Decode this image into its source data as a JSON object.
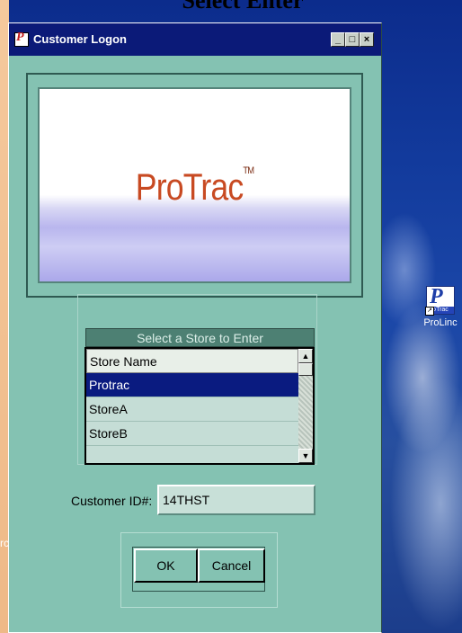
{
  "page_title": "Select Enter",
  "desktop": {
    "left_text": "rc",
    "icon": {
      "name": "protrac-icon",
      "glyph": "P",
      "sub": "oTrac",
      "shortcut_arrow": "↗",
      "label": "ProLinc"
    }
  },
  "window": {
    "title": "Customer Logon",
    "controls": {
      "minimize": "_",
      "maximize": "□",
      "close": "×"
    },
    "app_icon_glyph": "P",
    "logo": {
      "text": "ProTrac",
      "tm": "TM"
    },
    "store_list": {
      "header": "Select a Store to Enter",
      "rows": [
        {
          "label": "Store Name",
          "type": "header"
        },
        {
          "label": "Protrac",
          "type": "selected"
        },
        {
          "label": "StoreA",
          "type": "normal"
        },
        {
          "label": "StoreB",
          "type": "normal"
        }
      ],
      "scroll_up": "▲",
      "scroll_down": "▼"
    },
    "customer_id": {
      "label": "Customer ID#:",
      "value": "14THST"
    },
    "buttons": {
      "ok": "OK",
      "cancel": "Cancel"
    }
  },
  "colors": {
    "window_bg": "#84c2b2",
    "titlebar": "#0b1a78",
    "selection": "#0a1b80",
    "logo_text": "#c84a22"
  }
}
